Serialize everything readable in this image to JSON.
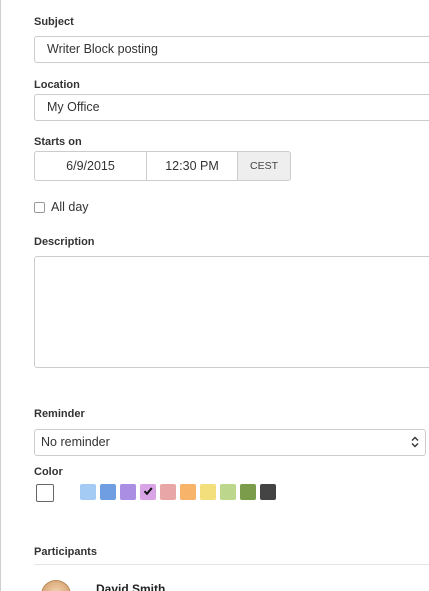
{
  "form": {
    "subject_label": "Subject",
    "subject_value": "Writer Block posting",
    "location_label": "Location",
    "location_value": "My Office",
    "starts_on_label": "Starts on",
    "start_date": "6/9/2015",
    "start_time": "12:30 PM",
    "timezone": "CEST",
    "all_day_label": "All day",
    "all_day_checked": false,
    "description_label": "Description",
    "description_value": "",
    "reminder_label": "Reminder",
    "reminder_value": "No reminder",
    "color_label": "Color",
    "participants_label": "Participants"
  },
  "colors": [
    {
      "name": "light-blue",
      "hex": "#a4cbf3",
      "selected": false
    },
    {
      "name": "blue",
      "hex": "#6f9ee3",
      "selected": false
    },
    {
      "name": "purple",
      "hex": "#a98ee3",
      "selected": false
    },
    {
      "name": "lilac",
      "hex": "#d8a4e6",
      "selected": true
    },
    {
      "name": "pink",
      "hex": "#e8a6a6",
      "selected": false
    },
    {
      "name": "orange",
      "hex": "#f7b36a",
      "selected": false
    },
    {
      "name": "yellow",
      "hex": "#f3df7c",
      "selected": false
    },
    {
      "name": "light-green",
      "hex": "#bcd68c",
      "selected": false
    },
    {
      "name": "green",
      "hex": "#7b9c4a",
      "selected": false
    },
    {
      "name": "dark-gray",
      "hex": "#444444",
      "selected": false
    }
  ],
  "participants": [
    {
      "name": "David Smith"
    }
  ]
}
